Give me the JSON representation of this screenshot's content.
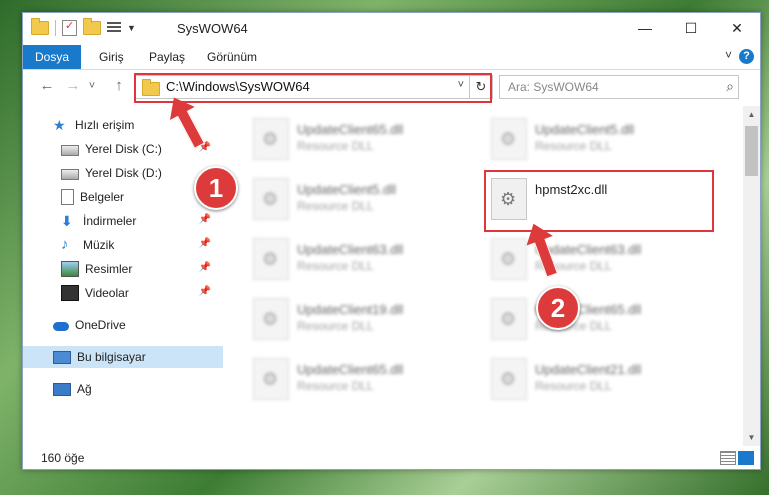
{
  "window": {
    "title": "SysWOW64"
  },
  "window_controls": {
    "minimize": "—",
    "maximize": "☐",
    "close": "✕"
  },
  "ribbon": {
    "tabs": [
      {
        "label": "Dosya"
      },
      {
        "label": "Giriş"
      },
      {
        "label": "Paylaş"
      },
      {
        "label": "Görünüm"
      }
    ],
    "help": "?"
  },
  "navigation": {
    "back": "←",
    "forward": "→",
    "recent": "˅",
    "up": "↑",
    "address": "C:\\Windows\\SysWOW64",
    "address_dropdown": "˅",
    "refresh": "↻",
    "search_placeholder": "Ara: SysWOW64",
    "search_icon": "⌕"
  },
  "sidebar": {
    "items": [
      {
        "label": "Hızlı erişim",
        "icon": "star-icon",
        "pinned": false
      },
      {
        "label": "Yerel Disk (C:)",
        "icon": "drive-icon",
        "pinned": true
      },
      {
        "label": "Yerel Disk (D:)",
        "icon": "drive-icon",
        "pinned": false
      },
      {
        "label": "Belgeler",
        "icon": "documents-icon",
        "pinned": true
      },
      {
        "label": "İndirmeler",
        "icon": "downloads-icon",
        "pinned": true
      },
      {
        "label": "Müzik",
        "icon": "music-icon",
        "pinned": true
      },
      {
        "label": "Resimler",
        "icon": "pictures-icon",
        "pinned": true
      },
      {
        "label": "Videolar",
        "icon": "videos-icon",
        "pinned": true
      },
      {
        "label": "OneDrive",
        "icon": "onedrive-icon",
        "pinned": false
      },
      {
        "label": "Bu bilgisayar",
        "icon": "computer-icon",
        "pinned": false,
        "selected": true
      },
      {
        "label": "Ağ",
        "icon": "network-icon",
        "pinned": false
      }
    ],
    "pin_glyph": "📌"
  },
  "files": [
    {
      "name": "UpdateClient65.dll",
      "type": "Resource DLL",
      "blurred": true
    },
    {
      "name": "UpdateClient5.dll",
      "type": "Resource DLL",
      "blurred": true
    },
    {
      "name": "UpdateClient5.dll",
      "type": "Resource DLL",
      "blurred": true
    },
    {
      "name": "hpmst2xc.dll",
      "type": "",
      "blurred": false
    },
    {
      "name": "UpdateClient63.dll",
      "type": "Resource DLL",
      "blurred": true
    },
    {
      "name": "UpdateClient63.dll",
      "type": "Resource DLL",
      "blurred": true
    },
    {
      "name": "UpdateClient19.dll",
      "type": "Resource DLL",
      "blurred": true
    },
    {
      "name": "UpdateClient65.dll",
      "type": "Resource DLL",
      "blurred": true
    },
    {
      "name": "UpdateClient65.dll",
      "type": "Resource DLL",
      "blurred": true
    },
    {
      "name": "UpdateClient21.dll",
      "type": "Resource DLL",
      "blurred": true
    }
  ],
  "status": {
    "count": "160 öğe"
  },
  "annotations": {
    "step1": "1",
    "step2": "2",
    "color": "#dd3b3b"
  },
  "colors": {
    "accent": "#1979ca",
    "selected": "#cce4f7"
  }
}
